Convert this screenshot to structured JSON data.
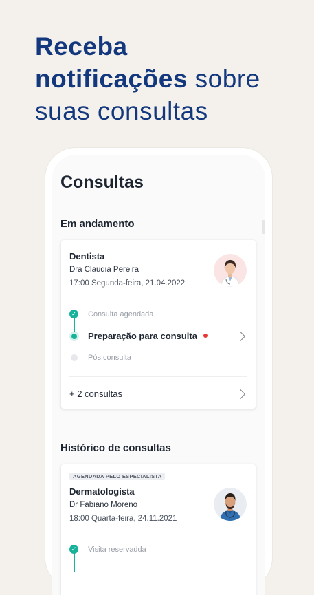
{
  "headline": {
    "line1_bold": "Receba",
    "line2_bold": "notificações",
    "line2_rest": " sobre",
    "line3": "suas consultas"
  },
  "screen": {
    "title": "Consultas",
    "in_progress_title": "Em andamento",
    "history_title": "Histórico de consultas"
  },
  "current_card": {
    "category": "Dentista",
    "doctor": "Dra Claudia Pereira",
    "datetime": "17:00 Segunda-feira, 21.04.2022",
    "steps": [
      {
        "label": "Consulta agendada",
        "state": "done"
      },
      {
        "label": "Preparação para consulta",
        "state": "active"
      },
      {
        "label": "Pós consulta",
        "state": "pending"
      }
    ],
    "more_link": "+ 2 consultas"
  },
  "history_card": {
    "badge": "AGENDADA PELO ESPECIALISTA",
    "category": "Dermatologista",
    "doctor": "Dr Fabiano Moreno",
    "datetime": "18:00 Quarta-feira, 24.11.2021",
    "steps": [
      {
        "label": "Visita reservadda",
        "state": "done"
      }
    ]
  },
  "colors": {
    "headline": "#13387e",
    "accent_green": "#17b29a",
    "notification_red": "#e53935",
    "background": "#f4f1ec"
  }
}
